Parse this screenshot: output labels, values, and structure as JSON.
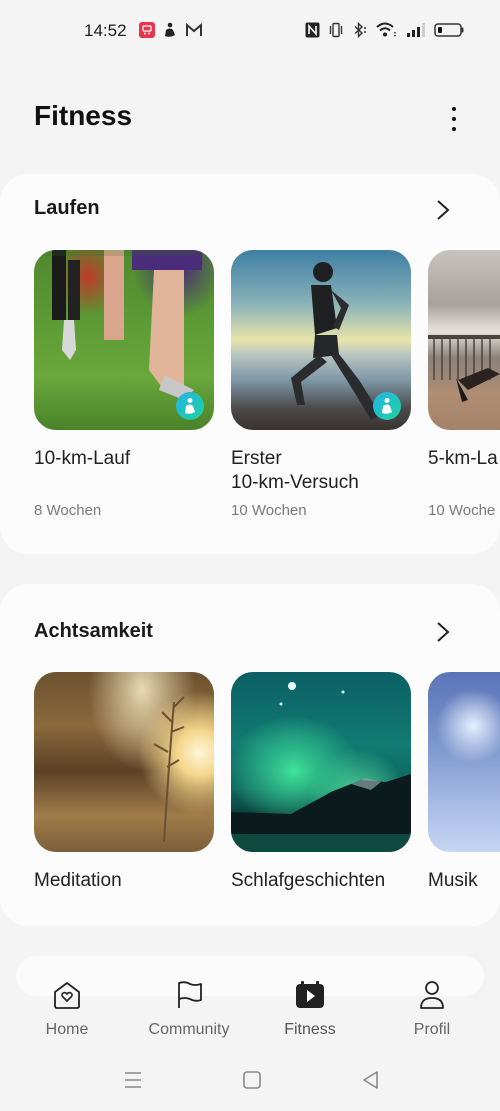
{
  "status_bar": {
    "time": "14:52",
    "app_icons": [
      "screen-record-icon",
      "fitness-app-icon",
      "gmail-icon"
    ],
    "system_icons": [
      "nfc-icon",
      "vibrate-icon",
      "bluetooth-icon",
      "wifi-icon",
      "signal-icon",
      "battery-icon"
    ],
    "colors": {
      "screen_record": "#e8344a"
    }
  },
  "header": {
    "title": "Fitness",
    "more_icon": "more-vert-icon"
  },
  "sections": [
    {
      "title": "Laufen",
      "items": [
        {
          "title": "10-km-Lauf",
          "subtitle": "8 Wochen",
          "image": "runners-on-grass",
          "badge": true
        },
        {
          "title": "Erster 10-km-Versuch",
          "title_lines": [
            "Erster",
            "10-km-Versuch"
          ],
          "subtitle": "10 Wochen",
          "image": "woman-running-beach",
          "badge": true
        },
        {
          "title": "5-km-La",
          "subtitle": "10 Woche",
          "image": "runner-boardwalk",
          "badge": false
        }
      ]
    },
    {
      "title": "Achtsamkeit",
      "items": [
        {
          "title": "Meditation",
          "image": "grass-sunset"
        },
        {
          "title": "Schlafgeschichten",
          "image": "aurora-mountains"
        },
        {
          "title": "Musik",
          "image": "blue-bokeh"
        }
      ]
    }
  ],
  "bottom_nav": {
    "items": [
      {
        "label": "Home",
        "icon": "home-heart-icon",
        "active": false
      },
      {
        "label": "Community",
        "icon": "flag-icon",
        "active": false
      },
      {
        "label": "Fitness",
        "icon": "fitness-play-icon",
        "active": true
      },
      {
        "label": "Profil",
        "icon": "person-icon",
        "active": false
      }
    ]
  },
  "system_nav": [
    "menu-icon",
    "home-square-icon",
    "back-triangle-icon"
  ],
  "colors": {
    "background": "#f4f4f4",
    "card": "#fcfcfc",
    "badge_gradient_start": "#23b3e8",
    "badge_gradient_end": "#1fd39b"
  }
}
